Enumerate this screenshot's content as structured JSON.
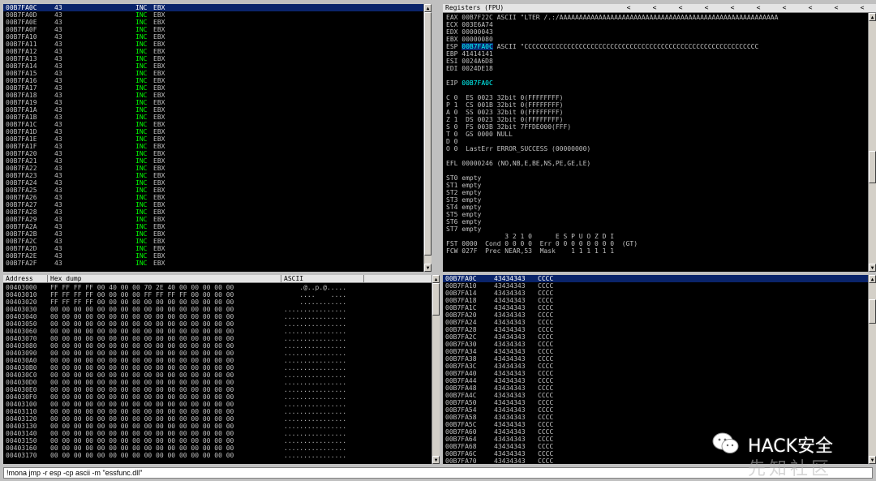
{
  "disasm": {
    "selected_index": 0,
    "rows": [
      {
        "a": "00B7FA0C",
        "b": "43",
        "m": "INC",
        "o": "EBX"
      },
      {
        "a": "00B7FA0D",
        "b": "43",
        "m": "INC",
        "o": "EBX"
      },
      {
        "a": "00B7FA0E",
        "b": "43",
        "m": "INC",
        "o": "EBX"
      },
      {
        "a": "00B7FA0F",
        "b": "43",
        "m": "INC",
        "o": "EBX"
      },
      {
        "a": "00B7FA10",
        "b": "43",
        "m": "INC",
        "o": "EBX"
      },
      {
        "a": "00B7FA11",
        "b": "43",
        "m": "INC",
        "o": "EBX"
      },
      {
        "a": "00B7FA12",
        "b": "43",
        "m": "INC",
        "o": "EBX"
      },
      {
        "a": "00B7FA13",
        "b": "43",
        "m": "INC",
        "o": "EBX"
      },
      {
        "a": "00B7FA14",
        "b": "43",
        "m": "INC",
        "o": "EBX"
      },
      {
        "a": "00B7FA15",
        "b": "43",
        "m": "INC",
        "o": "EBX"
      },
      {
        "a": "00B7FA16",
        "b": "43",
        "m": "INC",
        "o": "EBX"
      },
      {
        "a": "00B7FA17",
        "b": "43",
        "m": "INC",
        "o": "EBX"
      },
      {
        "a": "00B7FA18",
        "b": "43",
        "m": "INC",
        "o": "EBX"
      },
      {
        "a": "00B7FA19",
        "b": "43",
        "m": "INC",
        "o": "EBX"
      },
      {
        "a": "00B7FA1A",
        "b": "43",
        "m": "INC",
        "o": "EBX"
      },
      {
        "a": "00B7FA1B",
        "b": "43",
        "m": "INC",
        "o": "EBX"
      },
      {
        "a": "00B7FA1C",
        "b": "43",
        "m": "INC",
        "o": "EBX"
      },
      {
        "a": "00B7FA1D",
        "b": "43",
        "m": "INC",
        "o": "EBX"
      },
      {
        "a": "00B7FA1E",
        "b": "43",
        "m": "INC",
        "o": "EBX"
      },
      {
        "a": "00B7FA1F",
        "b": "43",
        "m": "INC",
        "o": "EBX"
      },
      {
        "a": "00B7FA20",
        "b": "43",
        "m": "INC",
        "o": "EBX"
      },
      {
        "a": "00B7FA21",
        "b": "43",
        "m": "INC",
        "o": "EBX"
      },
      {
        "a": "00B7FA22",
        "b": "43",
        "m": "INC",
        "o": "EBX"
      },
      {
        "a": "00B7FA23",
        "b": "43",
        "m": "INC",
        "o": "EBX"
      },
      {
        "a": "00B7FA24",
        "b": "43",
        "m": "INC",
        "o": "EBX"
      },
      {
        "a": "00B7FA25",
        "b": "43",
        "m": "INC",
        "o": "EBX"
      },
      {
        "a": "00B7FA26",
        "b": "43",
        "m": "INC",
        "o": "EBX"
      },
      {
        "a": "00B7FA27",
        "b": "43",
        "m": "INC",
        "o": "EBX"
      },
      {
        "a": "00B7FA28",
        "b": "43",
        "m": "INC",
        "o": "EBX"
      },
      {
        "a": "00B7FA29",
        "b": "43",
        "m": "INC",
        "o": "EBX"
      },
      {
        "a": "00B7FA2A",
        "b": "43",
        "m": "INC",
        "o": "EBX"
      },
      {
        "a": "00B7FA2B",
        "b": "43",
        "m": "INC",
        "o": "EBX"
      },
      {
        "a": "00B7FA2C",
        "b": "43",
        "m": "INC",
        "o": "EBX"
      },
      {
        "a": "00B7FA2D",
        "b": "43",
        "m": "INC",
        "o": "EBX"
      },
      {
        "a": "00B7FA2E",
        "b": "43",
        "m": "INC",
        "o": "EBX"
      },
      {
        "a": "00B7FA2F",
        "b": "43",
        "m": "INC",
        "o": "EBX"
      }
    ]
  },
  "registers": {
    "title": "Registers (FPU)",
    "chevrons": [
      "<",
      "<",
      "<",
      "<",
      "<",
      "<",
      "<",
      "<",
      "<",
      "<",
      "<"
    ],
    "general": [
      {
        "n": "EAX",
        "v": "00B7F22C",
        "c": "ASCII \"LTER /.:/AAAAAAAAAAAAAAAAAAAAAAAAAAAAAAAAAAAAAAAAAAAAAAAAAAAAAAAA"
      },
      {
        "n": "ECX",
        "v": "003E6A74",
        "c": ""
      },
      {
        "n": "EDX",
        "v": "00000043",
        "c": ""
      },
      {
        "n": "EBX",
        "v": "00000080",
        "c": ""
      },
      {
        "n": "ESP",
        "v": "00B7FA0C",
        "c": "ASCII \"CCCCCCCCCCCCCCCCCCCCCCCCCCCCCCCCCCCCCCCCCCCCCCCCCCCCCCCCCCCC"
      },
      {
        "n": "EBP",
        "v": "41414141",
        "c": ""
      },
      {
        "n": "ESI",
        "v": "0024A6D8",
        "c": ""
      },
      {
        "n": "EDI",
        "v": "0024DE18",
        "c": ""
      }
    ],
    "eip": {
      "n": "EIP",
      "v": "00B7FA0C"
    },
    "flags": [
      "C 0  ES 0023 32bit 0(FFFFFFFF)",
      "P 1  CS 001B 32bit 0(FFFFFFFF)",
      "A 0  SS 0023 32bit 0(FFFFFFFF)",
      "Z 1  DS 0023 32bit 0(FFFFFFFF)",
      "S 0  FS 003B 32bit 7FFDE000(FFF)",
      "T 0  GS 0000 NULL",
      "D 0",
      "O 0  LastErr ERROR_SUCCESS (00000000)"
    ],
    "efl": "EFL 00000246 (NO,NB,E,BE,NS,PE,GE,LE)",
    "fpu": [
      "ST0 empty",
      "ST1 empty",
      "ST2 empty",
      "ST3 empty",
      "ST4 empty",
      "ST5 empty",
      "ST6 empty",
      "ST7 empty"
    ],
    "fpu_bits": "               3 2 1 0      E S P U O Z D I",
    "fst": "FST 0000  Cond 0 0 0 0  Err 0 0 0 0 0 0 0 0  (GT)",
    "fcw": "FCW 027F  Prec NEAR,53  Mask    1 1 1 1 1 1"
  },
  "dump": {
    "headers": [
      "Address",
      "Hex dump",
      "ASCII"
    ],
    "rows": [
      {
        "a": "00403000",
        "h": "FF FF FF FF 00 40 00 00 70 2E 40 00 00 00 00 00",
        "s": "    .@..p.@....."
      },
      {
        "a": "00403010",
        "h": "FF FF FF FF 00 00 00 00 FF FF FF FF 00 00 00 00",
        "s": "    ....    ...."
      },
      {
        "a": "00403020",
        "h": "FF FF FF FF 00 00 00 00 00 00 00 00 00 00 00 00",
        "s": "    ............"
      },
      {
        "a": "00403030",
        "h": "00 00 00 00 00 00 00 00 00 00 00 00 00 00 00 00",
        "s": "................"
      },
      {
        "a": "00403040",
        "h": "00 00 00 00 00 00 00 00 00 00 00 00 00 00 00 00",
        "s": "................"
      },
      {
        "a": "00403050",
        "h": "00 00 00 00 00 00 00 00 00 00 00 00 00 00 00 00",
        "s": "................"
      },
      {
        "a": "00403060",
        "h": "00 00 00 00 00 00 00 00 00 00 00 00 00 00 00 00",
        "s": "................"
      },
      {
        "a": "00403070",
        "h": "00 00 00 00 00 00 00 00 00 00 00 00 00 00 00 00",
        "s": "................"
      },
      {
        "a": "00403080",
        "h": "00 00 00 00 00 00 00 00 00 00 00 00 00 00 00 00",
        "s": "................"
      },
      {
        "a": "00403090",
        "h": "00 00 00 00 00 00 00 00 00 00 00 00 00 00 00 00",
        "s": "................"
      },
      {
        "a": "004030A0",
        "h": "00 00 00 00 00 00 00 00 00 00 00 00 00 00 00 00",
        "s": "................"
      },
      {
        "a": "004030B0",
        "h": "00 00 00 00 00 00 00 00 00 00 00 00 00 00 00 00",
        "s": "................"
      },
      {
        "a": "004030C0",
        "h": "00 00 00 00 00 00 00 00 00 00 00 00 00 00 00 00",
        "s": "................"
      },
      {
        "a": "004030D0",
        "h": "00 00 00 00 00 00 00 00 00 00 00 00 00 00 00 00",
        "s": "................"
      },
      {
        "a": "004030E0",
        "h": "00 00 00 00 00 00 00 00 00 00 00 00 00 00 00 00",
        "s": "................"
      },
      {
        "a": "004030F0",
        "h": "00 00 00 00 00 00 00 00 00 00 00 00 00 00 00 00",
        "s": "................"
      },
      {
        "a": "00403100",
        "h": "00 00 00 00 00 00 00 00 00 00 00 00 00 00 00 00",
        "s": "................"
      },
      {
        "a": "00403110",
        "h": "00 00 00 00 00 00 00 00 00 00 00 00 00 00 00 00",
        "s": "................"
      },
      {
        "a": "00403120",
        "h": "00 00 00 00 00 00 00 00 00 00 00 00 00 00 00 00",
        "s": "................"
      },
      {
        "a": "00403130",
        "h": "00 00 00 00 00 00 00 00 00 00 00 00 00 00 00 00",
        "s": "................"
      },
      {
        "a": "00403140",
        "h": "00 00 00 00 00 00 00 00 00 00 00 00 00 00 00 00",
        "s": "................"
      },
      {
        "a": "00403150",
        "h": "00 00 00 00 00 00 00 00 00 00 00 00 00 00 00 00",
        "s": "................"
      },
      {
        "a": "00403160",
        "h": "00 00 00 00 00 00 00 00 00 00 00 00 00 00 00 00",
        "s": "................"
      },
      {
        "a": "00403170",
        "h": "00 00 00 00 00 00 00 00 00 00 00 00 00 00 00 00",
        "s": "................"
      }
    ]
  },
  "stack": {
    "selected_index": 0,
    "rows": [
      {
        "a": "00B7FA0C",
        "v": "43434343",
        "c": "CCCC"
      },
      {
        "a": "00B7FA10",
        "v": "43434343",
        "c": "CCCC"
      },
      {
        "a": "00B7FA14",
        "v": "43434343",
        "c": "CCCC"
      },
      {
        "a": "00B7FA18",
        "v": "43434343",
        "c": "CCCC"
      },
      {
        "a": "00B7FA1C",
        "v": "43434343",
        "c": "CCCC"
      },
      {
        "a": "00B7FA20",
        "v": "43434343",
        "c": "CCCC"
      },
      {
        "a": "00B7FA24",
        "v": "43434343",
        "c": "CCCC"
      },
      {
        "a": "00B7FA28",
        "v": "43434343",
        "c": "CCCC"
      },
      {
        "a": "00B7FA2C",
        "v": "43434343",
        "c": "CCCC"
      },
      {
        "a": "00B7FA30",
        "v": "43434343",
        "c": "CCCC"
      },
      {
        "a": "00B7FA34",
        "v": "43434343",
        "c": "CCCC"
      },
      {
        "a": "00B7FA38",
        "v": "43434343",
        "c": "CCCC"
      },
      {
        "a": "00B7FA3C",
        "v": "43434343",
        "c": "CCCC"
      },
      {
        "a": "00B7FA40",
        "v": "43434343",
        "c": "CCCC"
      },
      {
        "a": "00B7FA44",
        "v": "43434343",
        "c": "CCCC"
      },
      {
        "a": "00B7FA48",
        "v": "43434343",
        "c": "CCCC"
      },
      {
        "a": "00B7FA4C",
        "v": "43434343",
        "c": "CCCC"
      },
      {
        "a": "00B7FA50",
        "v": "43434343",
        "c": "CCCC"
      },
      {
        "a": "00B7FA54",
        "v": "43434343",
        "c": "CCCC"
      },
      {
        "a": "00B7FA58",
        "v": "43434343",
        "c": "CCCC"
      },
      {
        "a": "00B7FA5C",
        "v": "43434343",
        "c": "CCCC"
      },
      {
        "a": "00B7FA60",
        "v": "43434343",
        "c": "CCCC"
      },
      {
        "a": "00B7FA64",
        "v": "43434343",
        "c": "CCCC"
      },
      {
        "a": "00B7FA68",
        "v": "43434343",
        "c": "CCCC"
      },
      {
        "a": "00B7FA6C",
        "v": "43434343",
        "c": "CCCC"
      },
      {
        "a": "00B7FA70",
        "v": "43434343",
        "c": "CCCC"
      }
    ]
  },
  "command": {
    "value": "!mona jmp -r esp -cp ascii -m \"essfunc.dll\""
  },
  "watermark": {
    "brand": "HACK安全",
    "site": "先知社区"
  },
  "colors": {
    "selection": "#0a246a",
    "mnemonic": "#00ff00",
    "highlight": "#00ffff",
    "pane": "#000000",
    "text": "#c0c0c0"
  }
}
